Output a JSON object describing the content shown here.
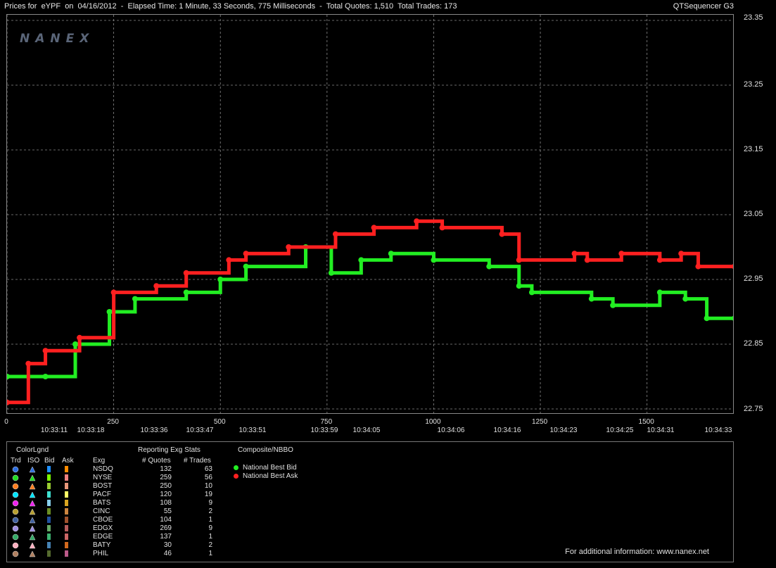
{
  "header": {
    "title": "Prices for  eYPF  on  04/16/2012  -  Elapsed Time: 1 Minute, 33 Seconds, 775 Milliseconds  -  Total Quotes: 1,510  Total Trades: 173",
    "app_name": "QTSequencer G3",
    "logo": "NANEX"
  },
  "chart_data": {
    "type": "line",
    "ylim": [
      22.75,
      23.35
    ],
    "xlim": [
      0,
      1705
    ],
    "y_ticks": [
      "23.35",
      "23.25",
      "23.15",
      "23.05",
      "22.95",
      "22.85",
      "22.75"
    ],
    "x_ticks": [
      "0",
      "250",
      "500",
      "750",
      "1000",
      "1250",
      "1500"
    ],
    "time_ticks": [
      "10:33:11",
      "10:33:18",
      "10:33:36",
      "10:33:47",
      "10:33:51",
      "10:33:59",
      "10:34:05",
      "10:34:06",
      "10:34:16",
      "10:34:23",
      "10:34:25",
      "10:34:31",
      "10:34:33"
    ],
    "series": [
      {
        "name": "National Best Bid",
        "color": "#22ee22",
        "points": [
          [
            0,
            22.8
          ],
          [
            90,
            22.8
          ],
          [
            160,
            22.85
          ],
          [
            240,
            22.9
          ],
          [
            300,
            22.92
          ],
          [
            420,
            22.93
          ],
          [
            500,
            22.95
          ],
          [
            560,
            22.97
          ],
          [
            700,
            23.0
          ],
          [
            760,
            22.96
          ],
          [
            830,
            22.98
          ],
          [
            900,
            22.99
          ],
          [
            1000,
            22.98
          ],
          [
            1130,
            22.97
          ],
          [
            1200,
            22.94
          ],
          [
            1230,
            22.93
          ],
          [
            1370,
            22.92
          ],
          [
            1420,
            22.91
          ],
          [
            1530,
            22.93
          ],
          [
            1590,
            22.92
          ],
          [
            1640,
            22.89
          ],
          [
            1705,
            22.89
          ]
        ]
      },
      {
        "name": "National Best Ask",
        "color": "#ff2020",
        "points": [
          [
            0,
            22.76
          ],
          [
            50,
            22.82
          ],
          [
            90,
            22.84
          ],
          [
            170,
            22.86
          ],
          [
            250,
            22.93
          ],
          [
            350,
            22.94
          ],
          [
            420,
            22.96
          ],
          [
            520,
            22.98
          ],
          [
            560,
            22.99
          ],
          [
            660,
            23.0
          ],
          [
            770,
            23.02
          ],
          [
            860,
            23.03
          ],
          [
            960,
            23.04
          ],
          [
            1020,
            23.03
          ],
          [
            1160,
            23.02
          ],
          [
            1200,
            22.98
          ],
          [
            1330,
            22.99
          ],
          [
            1360,
            22.98
          ],
          [
            1440,
            22.99
          ],
          [
            1530,
            22.98
          ],
          [
            1580,
            22.99
          ],
          [
            1620,
            22.97
          ],
          [
            1705,
            22.97
          ]
        ]
      }
    ]
  },
  "legend": {
    "headers": {
      "color_legend": "ColorLgnd",
      "trd": "Trd",
      "iso": "ISO",
      "bid": "Bid",
      "ask": "Ask",
      "exg": "Exg",
      "stats": "Reporting Exg Stats",
      "quotes": "# Quotes",
      "trades": "# Trades",
      "composite": "Composite/NBBO"
    },
    "exchanges": [
      {
        "exg": "NSDQ",
        "quotes": "132",
        "trades": "63",
        "trd": "#2f6fe0",
        "bid": "#1e90ff",
        "ask": "#ff8c00"
      },
      {
        "exg": "NYSE",
        "quotes": "259",
        "trades": "56",
        "trd": "#22dd22",
        "bid": "#7cfc00",
        "ask": "#f08080"
      },
      {
        "exg": "BOST",
        "quotes": "250",
        "trades": "10",
        "trd": "#ff7f20",
        "bid": "#9acd32",
        "ask": "#e9967a"
      },
      {
        "exg": "PACF",
        "quotes": "120",
        "trades": "19",
        "trd": "#00e5ff",
        "bid": "#40e0d0",
        "ask": "#ffff66"
      },
      {
        "exg": "BATS",
        "quotes": "108",
        "trades": "9",
        "trd": "#ee22ee",
        "bid": "#87ceeb",
        "ask": "#daa520"
      },
      {
        "exg": "CINC",
        "quotes": "55",
        "trades": "2",
        "trd": "#b8a030",
        "bid": "#6b8e23",
        "ask": "#cd853f"
      },
      {
        "exg": "CBOE",
        "quotes": "104",
        "trades": "1",
        "trd": "#4060a0",
        "bid": "#2050a0",
        "ask": "#a0522d"
      },
      {
        "exg": "EDGX",
        "quotes": "269",
        "trades": "9",
        "trd": "#a090e0",
        "bid": "#66aa66",
        "ask": "#b85c5c"
      },
      {
        "exg": "EDGE",
        "quotes": "137",
        "trades": "1",
        "trd": "#33aa66",
        "bid": "#3cb371",
        "ask": "#cc6666"
      },
      {
        "exg": "BATY",
        "quotes": "30",
        "trades": "2",
        "trd": "#ffb0c0",
        "bid": "#4682b4",
        "ask": "#d2691e"
      },
      {
        "exg": "PHIL",
        "quotes": "46",
        "trades": "1",
        "trd": "#b08060",
        "bid": "#556b2f",
        "ask": "#bc5a8a"
      }
    ],
    "nbbo": [
      {
        "label": "National Best Bid",
        "color": "#22ee22"
      },
      {
        "label": "National Best Ask",
        "color": "#ff2020"
      }
    ]
  },
  "footer": "For additional information: www.nanex.net"
}
